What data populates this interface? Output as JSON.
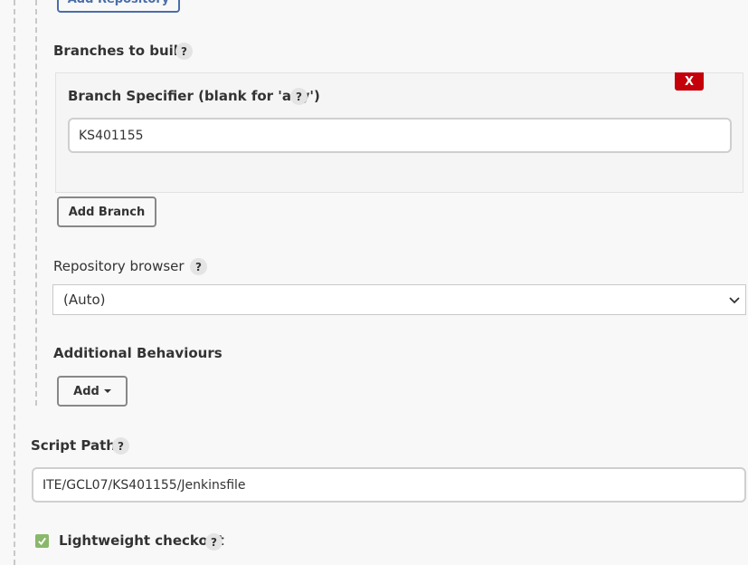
{
  "scm": {
    "add_repository_label": "Add Repository",
    "branches": {
      "title": "Branches to build",
      "help": "?",
      "specifier_label": "Branch Specifier (blank for 'any')",
      "specifier_help": "?",
      "specifier_value": "KS401155",
      "delete_label": "X",
      "add_branch_label": "Add Branch"
    },
    "repository_browser": {
      "label": "Repository browser",
      "help": "?",
      "selected": "(Auto)"
    },
    "additional_behaviours": {
      "title": "Additional Behaviours",
      "add_label": "Add"
    }
  },
  "script_path": {
    "label": "Script Path",
    "help": "?",
    "value": "ITE/GCL07/KS401155/Jenkinsfile"
  },
  "lightweight_checkout": {
    "label": "Lightweight checkout",
    "help": "?",
    "checked": true
  },
  "colors": {
    "delete_red": "#c4000a",
    "checkbox_green": "#8ab86a",
    "link_blue": "#4b6ea8"
  }
}
